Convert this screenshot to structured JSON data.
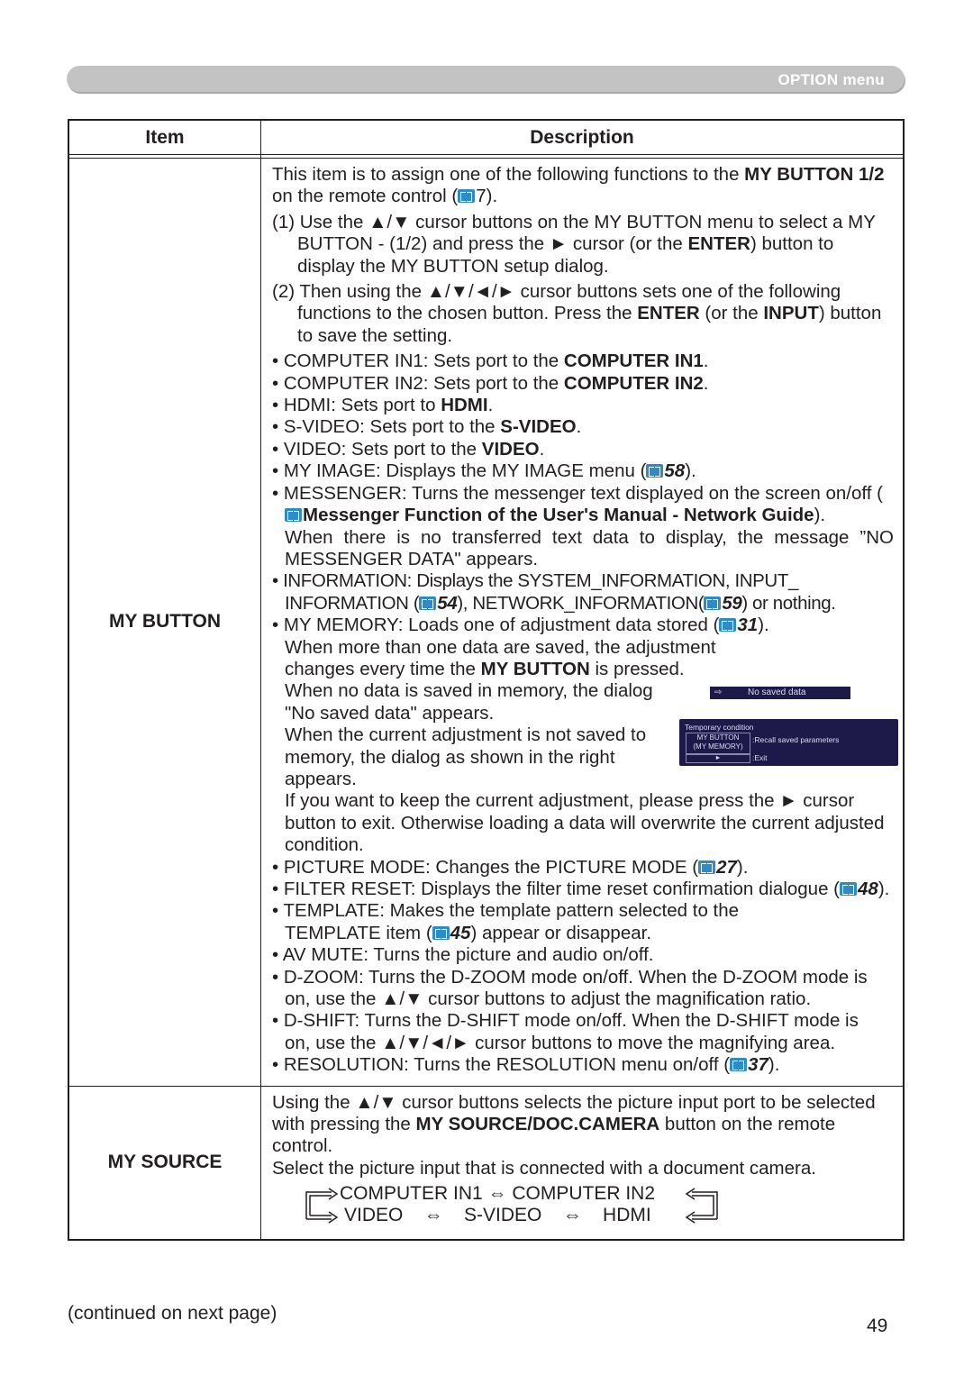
{
  "header": {
    "section_title": "OPTION menu"
  },
  "table": {
    "headers": {
      "item": "Item",
      "description": "Description"
    },
    "my_button": {
      "item": "MY BUTTON",
      "intro": {
        "t1": "This item is to assign one of the following functions to the ",
        "b1": "MY BUTTON 1/2",
        "t2": " on the remote control (",
        "ref": "7",
        "t3": ")."
      },
      "step1": {
        "t1": "(1) Use the ▲/▼ cursor buttons on the MY BUTTON menu to select a MY BUTTON - (1/2) and press the ► cursor (or the ",
        "b1": "ENTER",
        "t2": ") button to display the MY BUTTON setup dialog."
      },
      "step2": {
        "t1": "(2) Then using the ▲/▼/◄/► cursor buttons sets one of the following functions to the chosen button. Press the ",
        "b1": "ENTER",
        "t2": " (or the ",
        "b2": "INPUT",
        "t3": ") button to save the setting."
      },
      "bullets": {
        "computer_in1": {
          "t1": "• COMPUTER IN1: Sets port to the ",
          "b1": "COMPUTER IN1",
          "t2": "."
        },
        "computer_in2": {
          "t1": "• COMPUTER IN2: Sets port to the ",
          "b1": "COMPUTER IN2",
          "t2": "."
        },
        "hdmi": {
          "t1": "• HDMI: Sets port to ",
          "b1": "HDMI",
          "t2": "."
        },
        "svideo": {
          "t1": "• S-VIDEO: Sets port to the ",
          "b1": "S-VIDEO",
          "t2": "."
        },
        "video": {
          "t1": "• VIDEO: Sets port to the ",
          "b1": "VIDEO",
          "t2": "."
        },
        "my_image": {
          "t1": "• MY IMAGE: Displays the MY IMAGE menu (",
          "ref": "58",
          "t2": ")."
        },
        "messenger": {
          "t1": "• MESSENGER: Turns the messenger text displayed on the screen on/off (",
          "b1": "Messenger Function of the User's Manual - Network Guide",
          "t2": ").",
          "t3": "When there is no transferred text data to display, the message ”NO MESSENGER DATA\" appears."
        },
        "information": {
          "t1": "• INFORMATION: Displays the SYSTEM_INFORMATION, INPUT_ INFORMATION (",
          "ref1": "54",
          "t2": "), NETWORK_INFORMATION(",
          "ref2": "59",
          "t3": ") or nothing."
        },
        "my_memory": {
          "t1": "• MY MEMORY: Loads one of adjustment data stored (",
          "ref": "31",
          "t2": ").",
          "t3": "When more than one data are saved, the adjustment changes every time the ",
          "b1": "MY BUTTON",
          "t4": " is pressed.",
          "t5": "When no data is saved in memory, the dialog \"No saved data\" appears.",
          "t6": "When the current adjustment is not saved to memory, the dialog as shown in the right appears.",
          "t7": "If you want to keep the current adjustment, please press the ► cursor button to exit. Otherwise loading a data will overwrite the current adjusted condition."
        },
        "picture_mode": {
          "t1": "• PICTURE MODE: Changes the PICTURE MODE (",
          "ref": "27",
          "t2": ")."
        },
        "filter_reset": {
          "t1": "• FILTER RESET: Displays the filter time reset confirmation dialogue (",
          "ref": "48",
          "t2": ")."
        },
        "template": {
          "t1": "• TEMPLATE: Makes the template pattern selected to the TEMPLATE item (",
          "ref": "45",
          "t2": ") appear or disappear."
        },
        "av_mute": {
          "t1": "• AV MUTE: Turns the picture and audio on/off."
        },
        "d_zoom": {
          "t1": "• D-ZOOM: Turns the D-ZOOM mode on/off. When the D-ZOOM mode is on, use the ▲/▼ cursor buttons to adjust the magnification ratio."
        },
        "d_shift": {
          "t1": "• D-SHIFT: Turns the D-SHIFT mode on/off. When the D-SHIFT mode is on, use the ▲/▼/◄/► cursor buttons to move the magnifying area."
        },
        "resolution": {
          "t1": "• RESOLUTION: Turns the RESOLUTION menu on/off (",
          "ref": "37",
          "t2": ")."
        }
      },
      "osd_no_saved": {
        "icon": "input-arrow-icon",
        "text": "No saved data"
      },
      "osd_temporary": {
        "title": "Temporary condition",
        "button_line1": "MY BUTTON",
        "button_line2": "(MY MEMORY)",
        "button_desc": ":Recall saved parameters",
        "exit_key": "►",
        "exit_desc": ":Exit"
      }
    },
    "my_source": {
      "item": "MY SOURCE",
      "p1": {
        "t1": "Using the ▲/▼ cursor buttons selects the picture input port to be selected with pressing the ",
        "b1": "MY SOURCE/DOC.CAMERA",
        "t2": " button on the remote control."
      },
      "p2": "Select the picture input that is connected with a document camera.",
      "cycle": {
        "row1": "COMPUTER IN1 ⇔ COMPUTER IN2",
        "row2": "VIDEO    ⇔    S-VIDEO    ⇔    HDMI"
      }
    }
  },
  "footer": {
    "continued": "(continued on next page)",
    "page_number": "49"
  }
}
